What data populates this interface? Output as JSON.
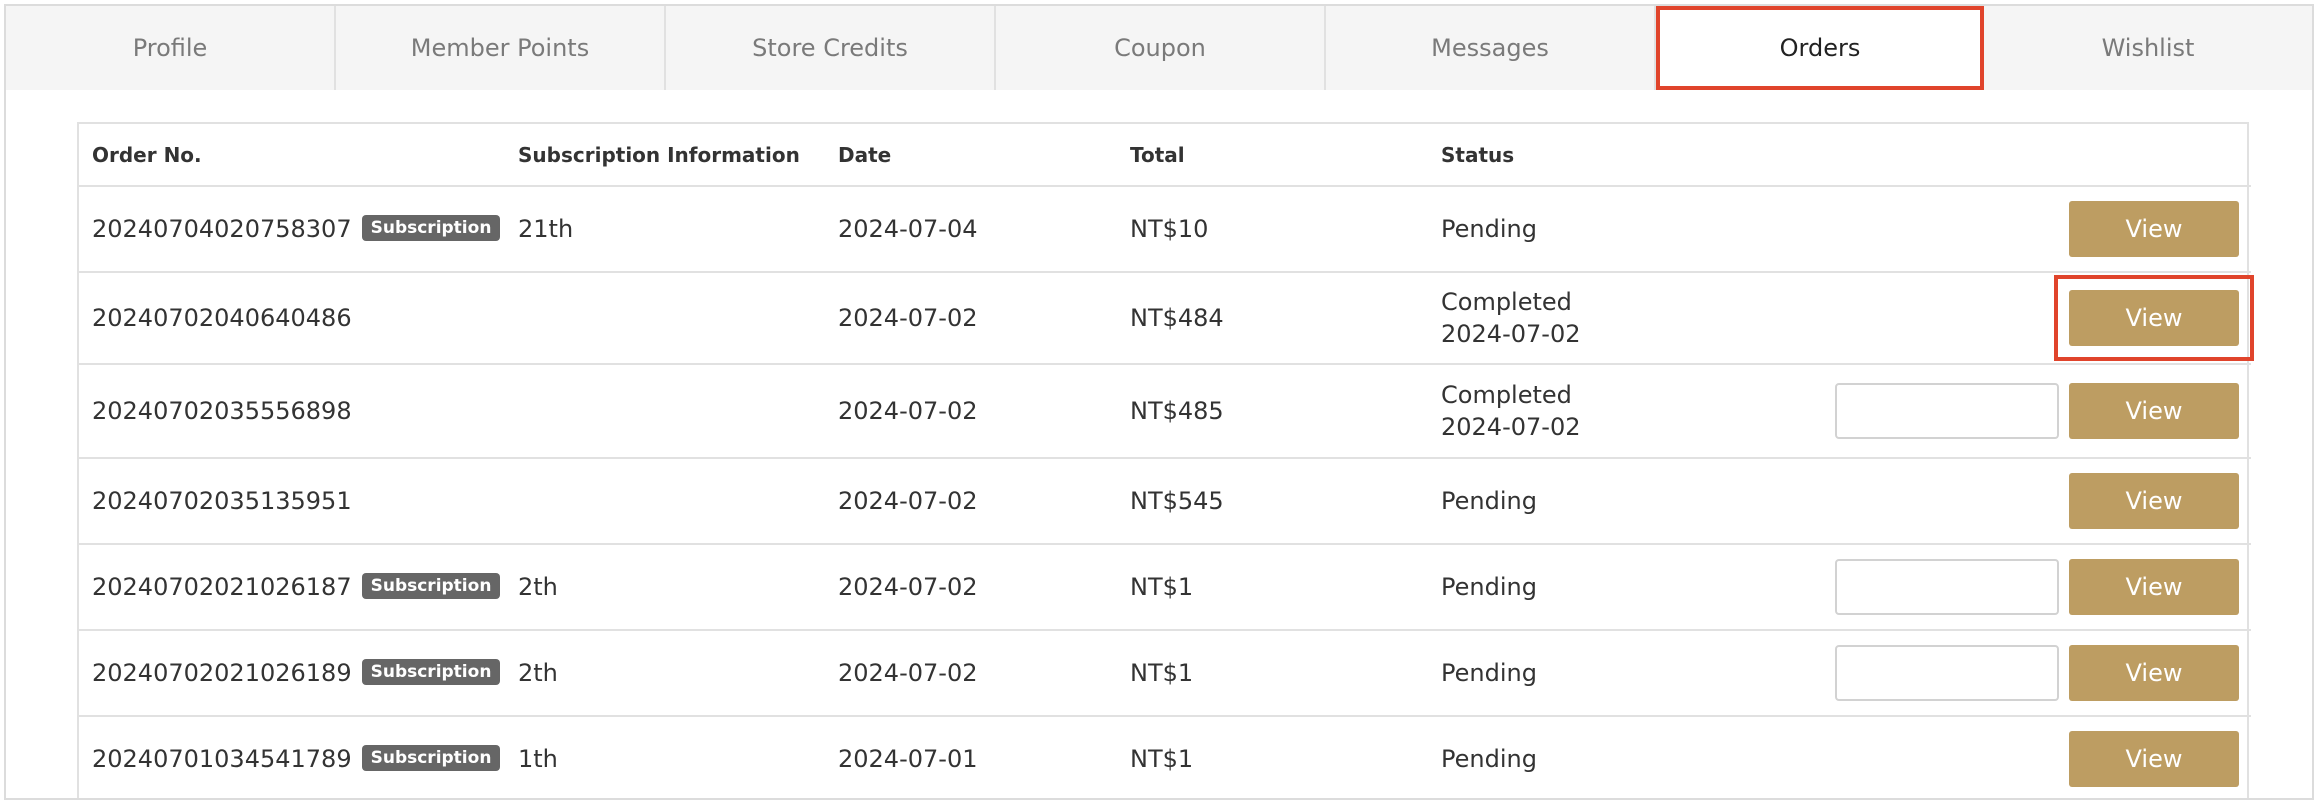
{
  "tabs": [
    {
      "label": "Profile"
    },
    {
      "label": "Member Points"
    },
    {
      "label": "Store Credits"
    },
    {
      "label": "Coupon"
    },
    {
      "label": "Messages"
    },
    {
      "label": "Orders"
    },
    {
      "label": "Wishlist"
    }
  ],
  "active_tab": "Orders",
  "highlight_color": "#e0442b",
  "accent_color": "#bd9d62",
  "table": {
    "columns": [
      "Order No.",
      "Subscription Information",
      "Date",
      "Total",
      "Status"
    ],
    "rows": [
      {
        "order_no": "20240704020758307",
        "badge": "Subscription",
        "subscription": "21th",
        "date": "2024-07-04",
        "total": "NT$10",
        "status": "Pending",
        "status_date": "",
        "has_field": false,
        "action": "View"
      },
      {
        "order_no": "20240702040640486",
        "badge": "",
        "subscription": "",
        "date": "2024-07-02",
        "total": "NT$484",
        "status": "Completed",
        "status_date": "2024-07-02",
        "has_field": false,
        "action": "View",
        "highlighted": true
      },
      {
        "order_no": "20240702035556898",
        "badge": "",
        "subscription": "",
        "date": "2024-07-02",
        "total": "NT$485",
        "status": "Completed",
        "status_date": "2024-07-02",
        "has_field": true,
        "action": "View"
      },
      {
        "order_no": "20240702035135951",
        "badge": "",
        "subscription": "",
        "date": "2024-07-02",
        "total": "NT$545",
        "status": "Pending",
        "status_date": "",
        "has_field": false,
        "action": "View"
      },
      {
        "order_no": "20240702021026187",
        "badge": "Subscription",
        "subscription": "2th",
        "date": "2024-07-02",
        "total": "NT$1",
        "status": "Pending",
        "status_date": "",
        "has_field": true,
        "action": "View"
      },
      {
        "order_no": "20240702021026189",
        "badge": "Subscription",
        "subscription": "2th",
        "date": "2024-07-02",
        "total": "NT$1",
        "status": "Pending",
        "status_date": "",
        "has_field": true,
        "action": "View"
      },
      {
        "order_no": "20240701034541789",
        "badge": "Subscription",
        "subscription": "1th",
        "date": "2024-07-01",
        "total": "NT$1",
        "status": "Pending",
        "status_date": "",
        "has_field": false,
        "action": "View"
      }
    ]
  }
}
